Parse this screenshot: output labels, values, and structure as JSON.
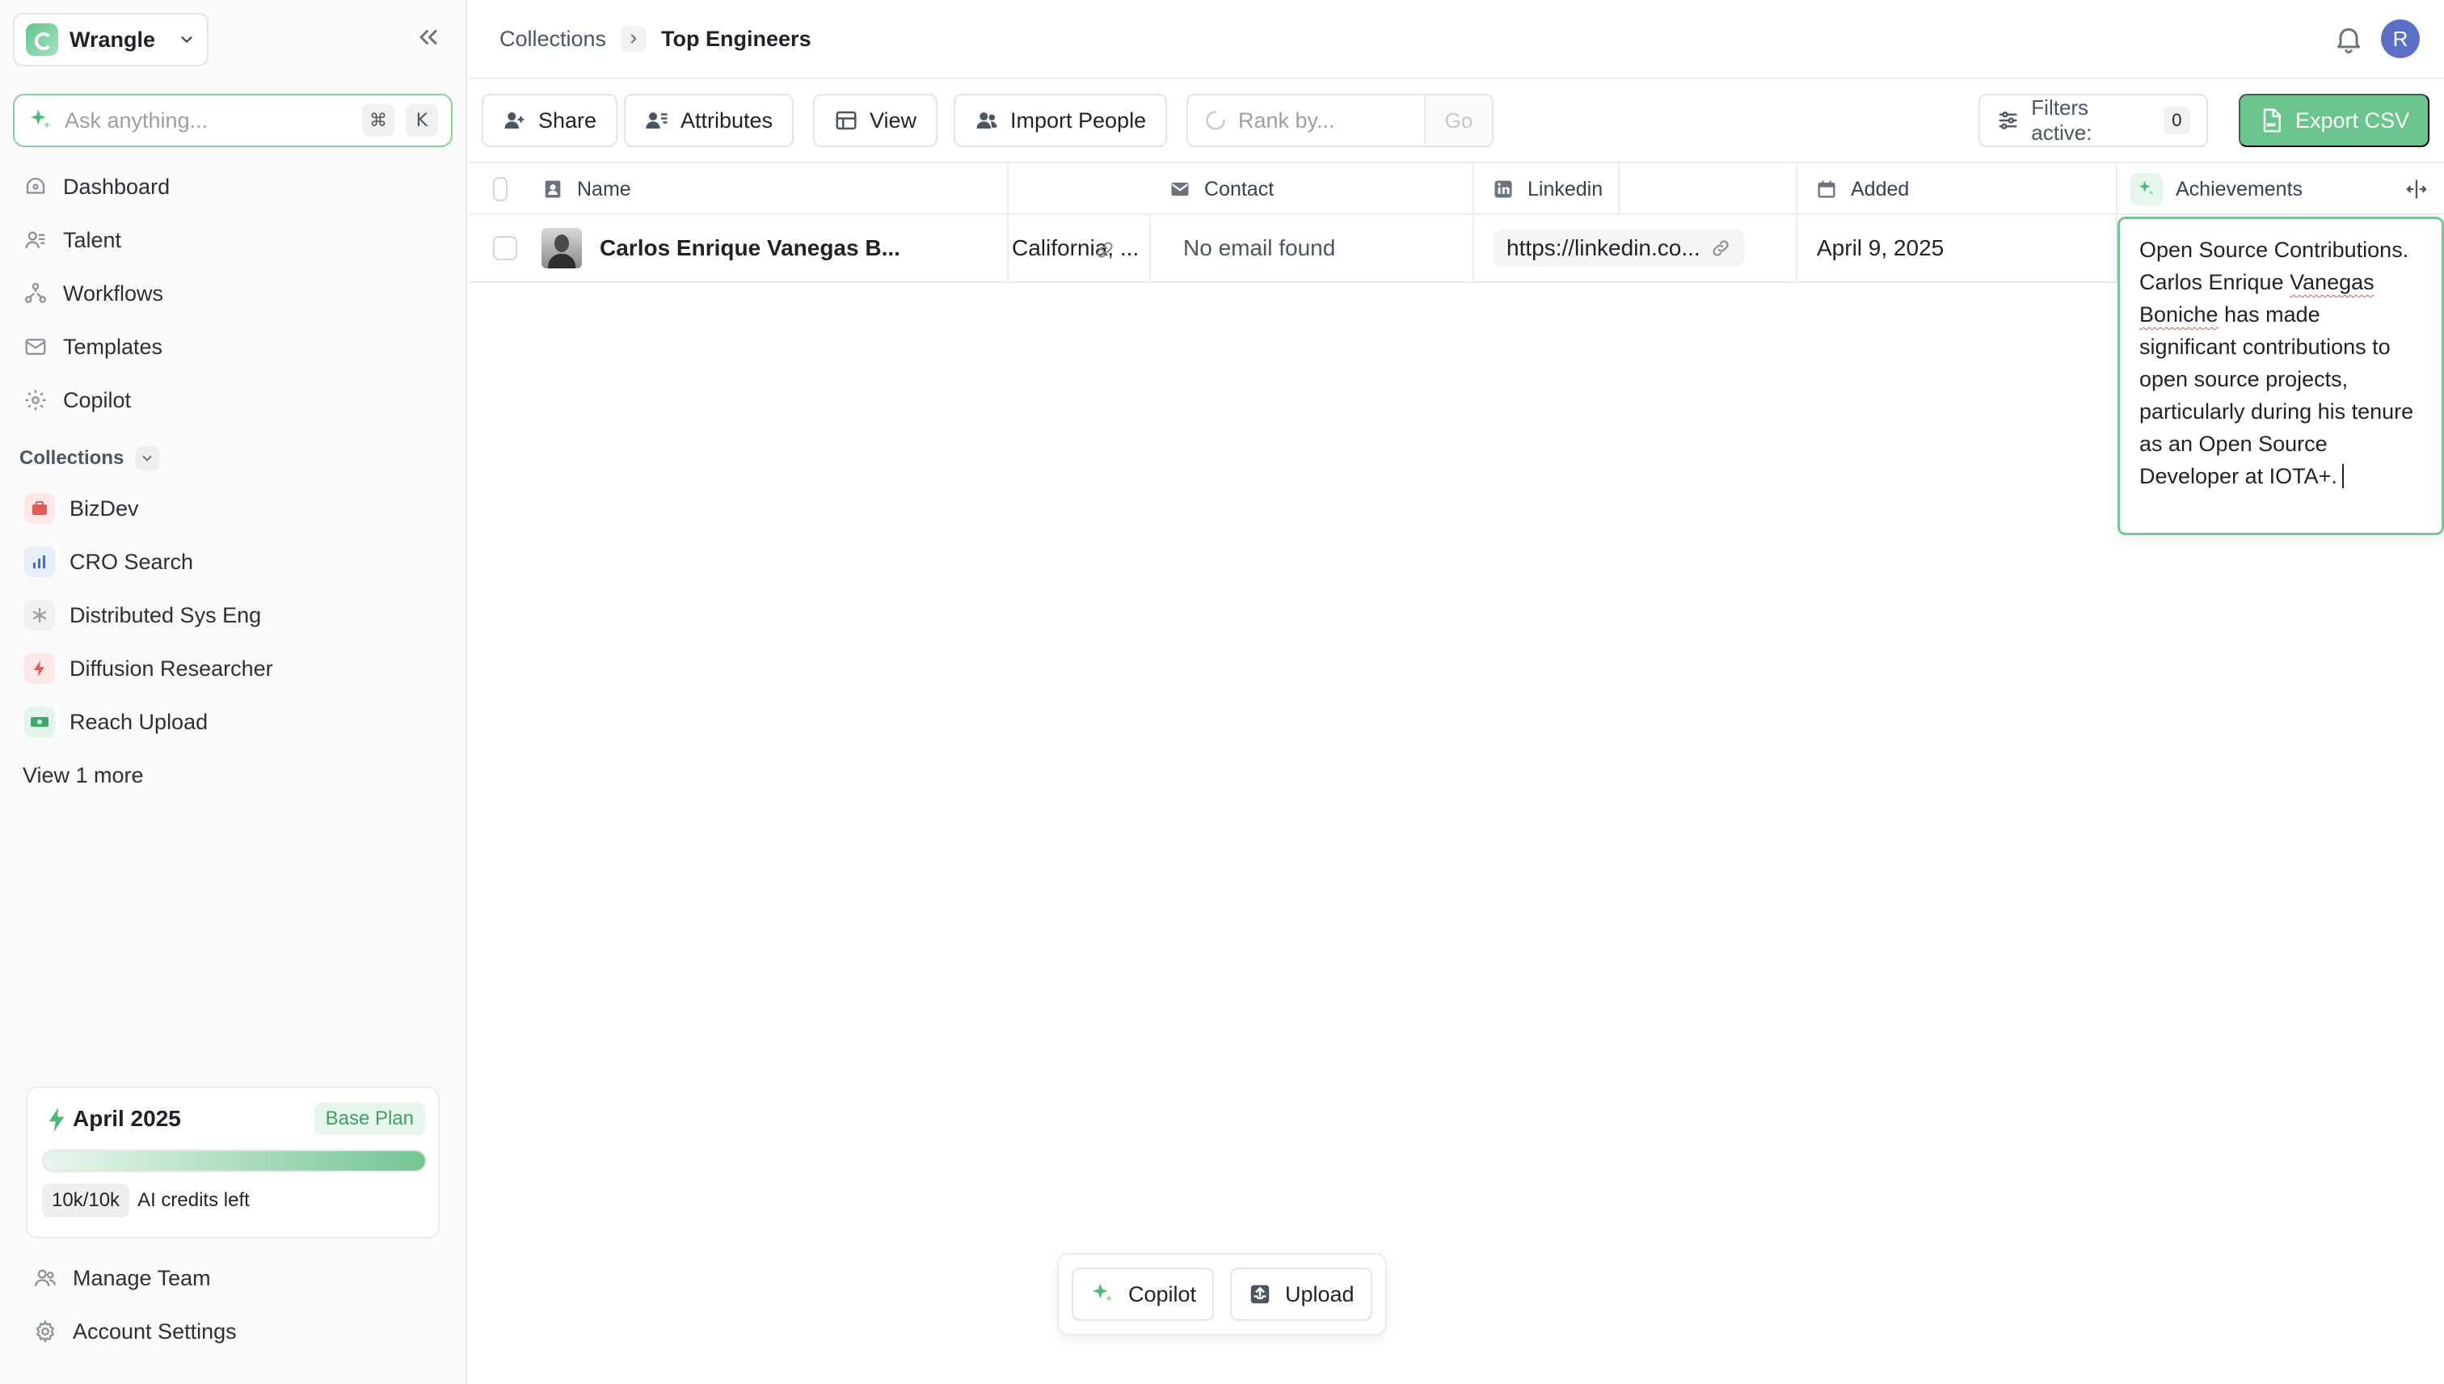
{
  "sidebar": {
    "workspace": "Wrangle",
    "ask": {
      "placeholder": "Ask anything...",
      "kbd1": "⌘",
      "kbd2": "K"
    },
    "nav": [
      {
        "label": "Dashboard",
        "icon": "dashboard-icon"
      },
      {
        "label": "Talent",
        "icon": "talent-icon"
      },
      {
        "label": "Workflows",
        "icon": "workflows-icon"
      },
      {
        "label": "Templates",
        "icon": "templates-icon"
      },
      {
        "label": "Copilot",
        "icon": "copilot-icon"
      }
    ],
    "collections_label": "Collections",
    "collections": [
      {
        "label": "BizDev",
        "icon": "briefcase-icon",
        "color": "#e25b5b",
        "bg": "#fde8e8"
      },
      {
        "label": "CRO Search",
        "icon": "bar-chart-icon",
        "color": "#3b6fd9",
        "bg": "#e6eefc"
      },
      {
        "label": "Distributed Sys Eng",
        "icon": "asterisk-icon",
        "color": "#9aa0a6",
        "bg": "#f1f1f1"
      },
      {
        "label": "Diffusion Researcher",
        "icon": "lightning-icon",
        "color": "#e25b5b",
        "bg": "#fde8e8"
      },
      {
        "label": "Reach Upload",
        "icon": "cash-icon",
        "color": "#3fa866",
        "bg": "#e3f5ea"
      }
    ],
    "view_more": "View 1 more",
    "plan": {
      "title": "April 2025",
      "badge": "Base Plan",
      "credits": "10k/10k",
      "credits_label": "AI credits left",
      "usage_fraction": 1.0
    },
    "bottom": [
      {
        "label": "Manage Team",
        "icon": "team-icon"
      },
      {
        "label": "Account Settings",
        "icon": "gear-icon"
      }
    ]
  },
  "header": {
    "breadcrumb_root": "Collections",
    "breadcrumb_current": "Top Engineers",
    "avatar_initial": "R"
  },
  "toolbar": {
    "share": "Share",
    "attributes": "Attributes",
    "view": "View",
    "import": "Import People",
    "rank_placeholder": "Rank by...",
    "go": "Go",
    "filters_label": "Filters active:",
    "filters_count": "0",
    "export": "Export CSV"
  },
  "table": {
    "columns": {
      "name": "Name",
      "location": "",
      "contact": "Contact",
      "linkedin": "Linkedin",
      "added": "Added",
      "achievements": "Achievements"
    },
    "rows": [
      {
        "name": "Carlos Enrique Vanegas B...",
        "location": "California, ...",
        "contact": "No email found",
        "linkedin": "https://linkedin.co...",
        "added": "April 9, 2025"
      }
    ],
    "achievement_before": "Open Source Contributions. Carlos Enrique ",
    "achievement_flag": "Vanegas Boniche",
    "achievement_after": " has made significant contributions to open source projects, particularly during his tenure as an Open Source Developer at IOTA+."
  },
  "float": {
    "copilot": "Copilot",
    "upload": "Upload"
  },
  "colors": {
    "accent": "#6cc48d",
    "accent_border": "#72c795"
  }
}
